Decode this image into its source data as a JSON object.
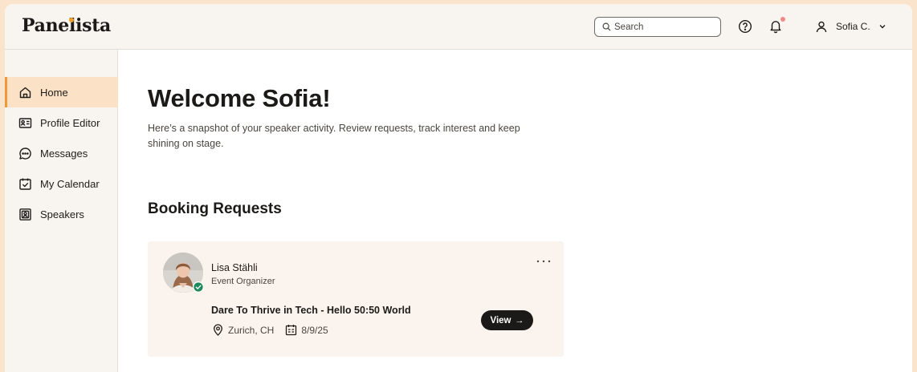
{
  "header": {
    "logo": "Panelista",
    "search_placeholder": "Search",
    "user_name": "Sofia C."
  },
  "sidebar": {
    "items": [
      {
        "label": "Home",
        "icon": "home-icon",
        "active": true
      },
      {
        "label": "Profile Editor",
        "icon": "id-card-icon",
        "active": false
      },
      {
        "label": "Messages",
        "icon": "chat-bubble-icon",
        "active": false
      },
      {
        "label": "My Calendar",
        "icon": "calendar-check-icon",
        "active": false
      },
      {
        "label": "Speakers",
        "icon": "contact-book-icon",
        "active": false
      }
    ]
  },
  "main": {
    "title": "Welcome Sofia!",
    "subtitle": "Here’s a snapshot of your speaker activity. Review requests, track interest and keep shining on stage.",
    "section_title": "Booking Requests",
    "booking": {
      "requester_name": "Lisa Stähli",
      "requester_role": "Event Organizer",
      "event_title": "Dare To Thrive in Tech - Hello 50:50 World",
      "location": "Zurich, CH",
      "date": "8/9/25",
      "view_label": "View",
      "view_arrow": "→"
    }
  },
  "colors": {
    "accent": "#ee9a3a",
    "active_nav_bg": "#fbe2c6",
    "header_bg": "#f8f5f1",
    "card_bg": "#fbf4ee",
    "button_bg": "#1c1a18",
    "verified": "#1f8a5b",
    "notification_dot": "#f08a86",
    "outer_bg": "#fbe4cc"
  }
}
